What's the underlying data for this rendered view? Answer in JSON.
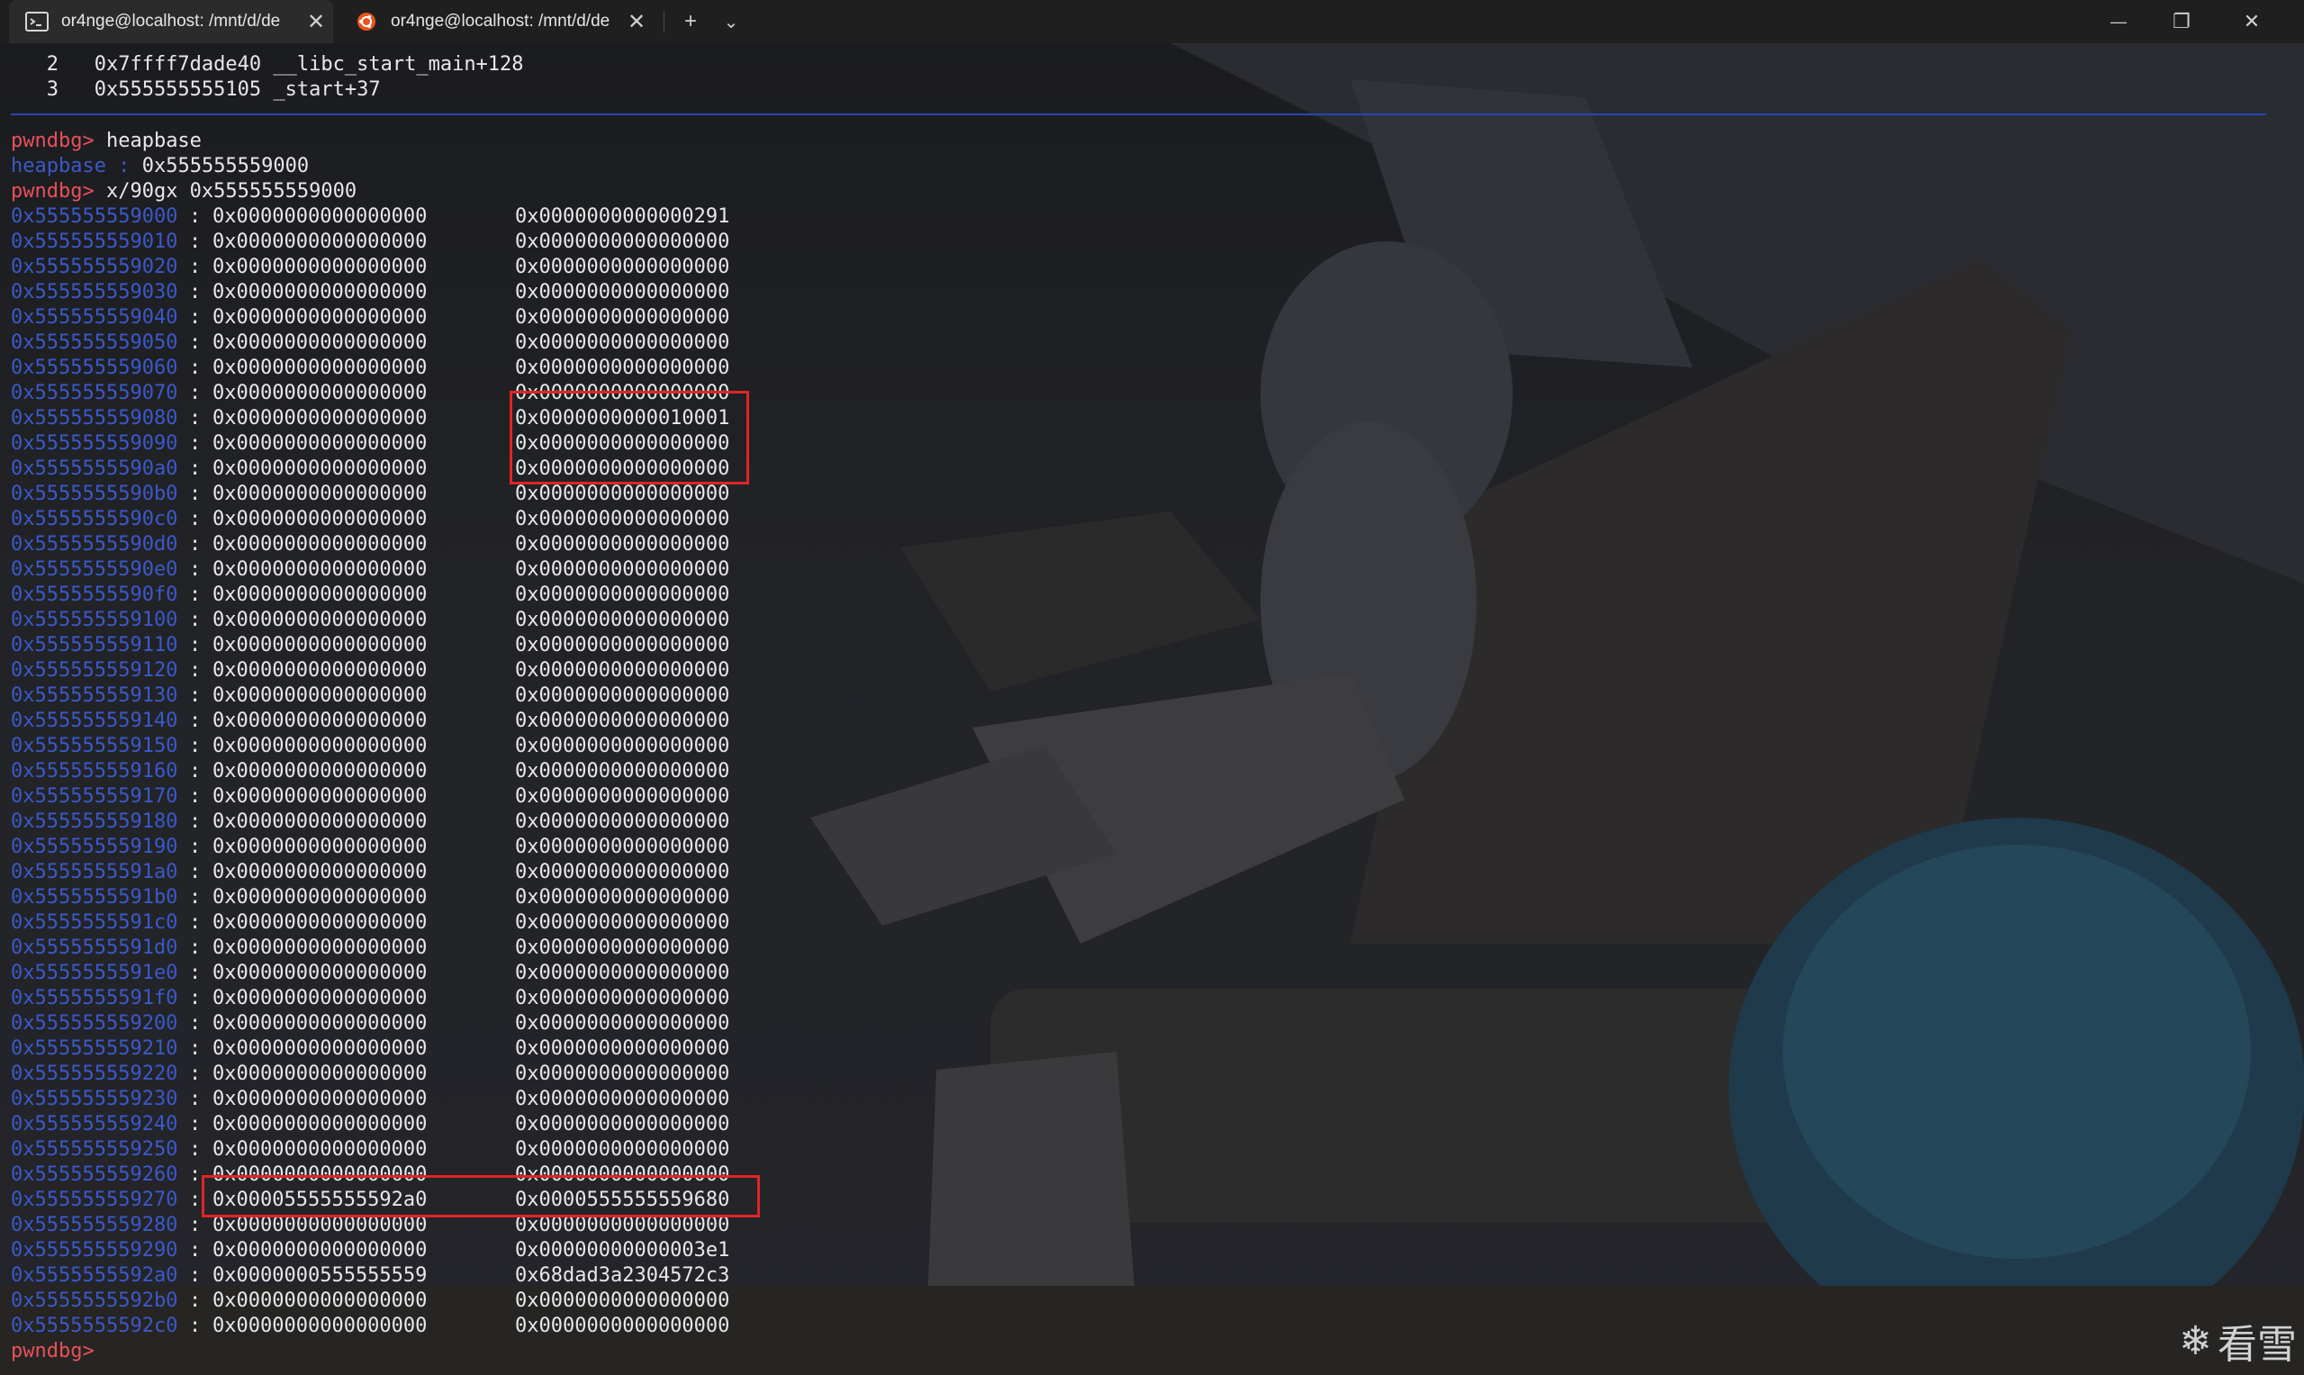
{
  "window": {
    "tabs": [
      {
        "label": "or4nge@localhost: /mnt/d/de",
        "icon": "terminal-icon",
        "active": true
      },
      {
        "label": "or4nge@localhost: /mnt/d/de",
        "icon": "ubuntu-icon",
        "active": false
      }
    ],
    "new_tab": "+",
    "dropdown": "⌄",
    "minimize": "—",
    "restore": "❐",
    "close": "✕"
  },
  "terminal": {
    "backtrace": [
      "   2   0x7ffff7dade40 __libc_start_main+128",
      "   3   0x555555555105 _start+37"
    ],
    "prompt": "pwndbg>",
    "cmd_heapbase": " heapbase",
    "heapbase_label": "heapbase",
    "heapbase_sep": " : ",
    "heapbase_value": "0x555555559000",
    "cmd_x": " x/90gx 0x555555559000",
    "rows": [
      [
        "0x555555559000",
        "0x0000000000000000",
        "0x0000000000000291"
      ],
      [
        "0x555555559010",
        "0x0000000000000000",
        "0x0000000000000000"
      ],
      [
        "0x555555559020",
        "0x0000000000000000",
        "0x0000000000000000"
      ],
      [
        "0x555555559030",
        "0x0000000000000000",
        "0x0000000000000000"
      ],
      [
        "0x555555559040",
        "0x0000000000000000",
        "0x0000000000000000"
      ],
      [
        "0x555555559050",
        "0x0000000000000000",
        "0x0000000000000000"
      ],
      [
        "0x555555559060",
        "0x0000000000000000",
        "0x0000000000000000"
      ],
      [
        "0x555555559070",
        "0x0000000000000000",
        "0x0000000000000000"
      ],
      [
        "0x555555559080",
        "0x0000000000000000",
        "0x0000000000010001"
      ],
      [
        "0x555555559090",
        "0x0000000000000000",
        "0x0000000000000000"
      ],
      [
        "0x5555555590a0",
        "0x0000000000000000",
        "0x0000000000000000"
      ],
      [
        "0x5555555590b0",
        "0x0000000000000000",
        "0x0000000000000000"
      ],
      [
        "0x5555555590c0",
        "0x0000000000000000",
        "0x0000000000000000"
      ],
      [
        "0x5555555590d0",
        "0x0000000000000000",
        "0x0000000000000000"
      ],
      [
        "0x5555555590e0",
        "0x0000000000000000",
        "0x0000000000000000"
      ],
      [
        "0x5555555590f0",
        "0x0000000000000000",
        "0x0000000000000000"
      ],
      [
        "0x555555559100",
        "0x0000000000000000",
        "0x0000000000000000"
      ],
      [
        "0x555555559110",
        "0x0000000000000000",
        "0x0000000000000000"
      ],
      [
        "0x555555559120",
        "0x0000000000000000",
        "0x0000000000000000"
      ],
      [
        "0x555555559130",
        "0x0000000000000000",
        "0x0000000000000000"
      ],
      [
        "0x555555559140",
        "0x0000000000000000",
        "0x0000000000000000"
      ],
      [
        "0x555555559150",
        "0x0000000000000000",
        "0x0000000000000000"
      ],
      [
        "0x555555559160",
        "0x0000000000000000",
        "0x0000000000000000"
      ],
      [
        "0x555555559170",
        "0x0000000000000000",
        "0x0000000000000000"
      ],
      [
        "0x555555559180",
        "0x0000000000000000",
        "0x0000000000000000"
      ],
      [
        "0x555555559190",
        "0x0000000000000000",
        "0x0000000000000000"
      ],
      [
        "0x5555555591a0",
        "0x0000000000000000",
        "0x0000000000000000"
      ],
      [
        "0x5555555591b0",
        "0x0000000000000000",
        "0x0000000000000000"
      ],
      [
        "0x5555555591c0",
        "0x0000000000000000",
        "0x0000000000000000"
      ],
      [
        "0x5555555591d0",
        "0x0000000000000000",
        "0x0000000000000000"
      ],
      [
        "0x5555555591e0",
        "0x0000000000000000",
        "0x0000000000000000"
      ],
      [
        "0x5555555591f0",
        "0x0000000000000000",
        "0x0000000000000000"
      ],
      [
        "0x555555559200",
        "0x0000000000000000",
        "0x0000000000000000"
      ],
      [
        "0x555555559210",
        "0x0000000000000000",
        "0x0000000000000000"
      ],
      [
        "0x555555559220",
        "0x0000000000000000",
        "0x0000000000000000"
      ],
      [
        "0x555555559230",
        "0x0000000000000000",
        "0x0000000000000000"
      ],
      [
        "0x555555559240",
        "0x0000000000000000",
        "0x0000000000000000"
      ],
      [
        "0x555555559250",
        "0x0000000000000000",
        "0x0000000000000000"
      ],
      [
        "0x555555559260",
        "0x0000000000000000",
        "0x0000000000000000"
      ],
      [
        "0x555555559270",
        "0x00005555555592a0",
        "0x0000555555559680"
      ],
      [
        "0x555555559280",
        "0x0000000000000000",
        "0x0000000000000000"
      ],
      [
        "0x555555559290",
        "0x0000000000000000",
        "0x00000000000003e1"
      ],
      [
        "0x5555555592a0",
        "0x0000000555555559",
        "0x68dad3a2304572c3"
      ],
      [
        "0x5555555592b0",
        "0x0000000000000000",
        "0x0000000000000000"
      ],
      [
        "0x5555555592c0",
        "0x0000000000000000",
        "0x0000000000000000"
      ]
    ],
    "final_prompt": "pwndbg>"
  },
  "watermark": "看雪",
  "colors": {
    "prompt": "#e8505b",
    "address": "#3b59c9",
    "text": "#e8e8e8",
    "highlight_box": "#e02525",
    "separator": "#2547b8"
  }
}
